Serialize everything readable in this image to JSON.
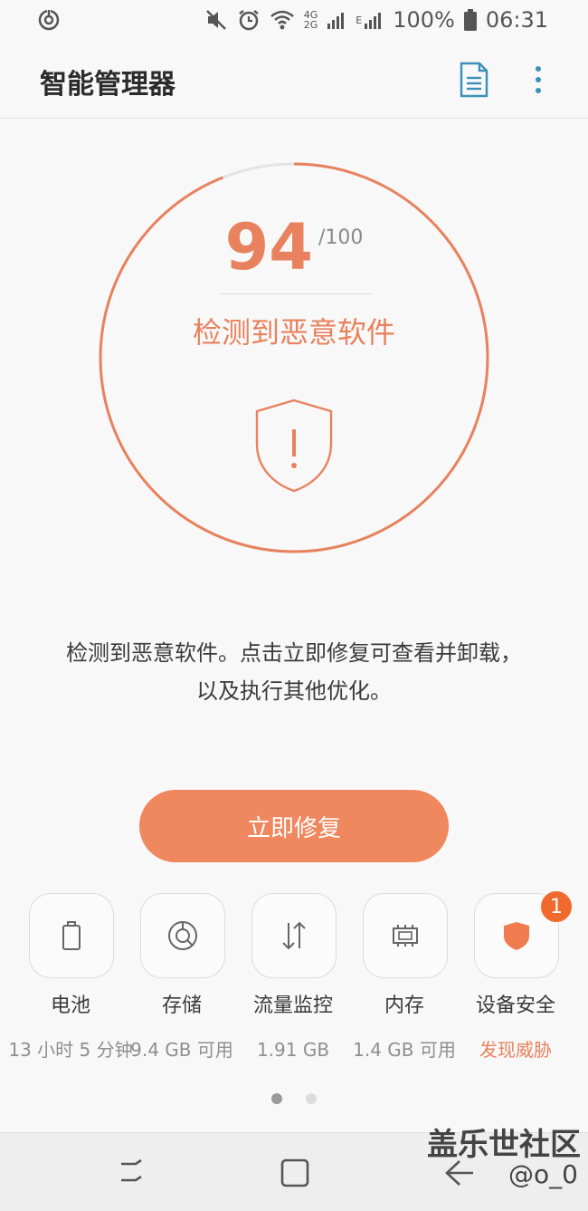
{
  "status_bar": {
    "battery_percent": "100%",
    "time": "06:31",
    "network_top": "4G",
    "network_bottom": "2G",
    "network_e": "E"
  },
  "app_bar": {
    "title": "智能管理器"
  },
  "gauge": {
    "score": "94",
    "max": "/100",
    "score_fraction": 0.94,
    "status": "检测到恶意软件",
    "accent_color": "#e8825e"
  },
  "description": {
    "line1": "检测到恶意软件。点击立即修复可查看并卸载，",
    "line2": "以及执行其他优化。"
  },
  "fix_button": {
    "label": "立即修复"
  },
  "tools": [
    {
      "label": "电池",
      "value": "13 小时 5 分钟",
      "icon": "battery-icon"
    },
    {
      "label": "存储",
      "value": "9.4 GB 可用",
      "icon": "storage-icon"
    },
    {
      "label": "流量监控",
      "value": "1.91 GB",
      "icon": "data-transfer-icon"
    },
    {
      "label": "内存",
      "value": "1.4 GB 可用",
      "icon": "memory-chip-icon"
    },
    {
      "label": "设备安全",
      "value": "发现威胁",
      "icon": "shield-icon",
      "badge": "1"
    }
  ],
  "page_indicator": {
    "total": 2,
    "current": 1
  },
  "watermark": {
    "line1": "盖乐世社区",
    "line2": "@o_0"
  }
}
